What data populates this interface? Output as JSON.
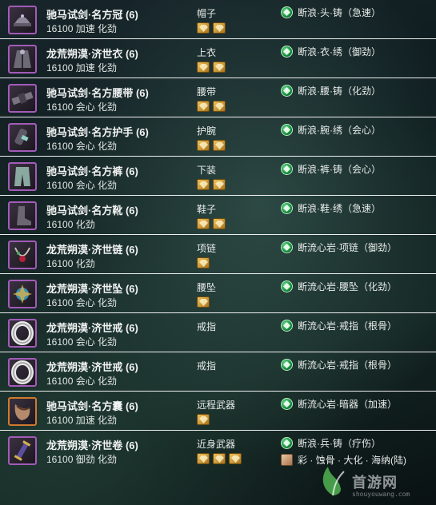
{
  "rows": [
    {
      "name": "驰马试剑·名方冠 (6)",
      "stats": "16100 加速 化劲",
      "slot": "帽子",
      "gems": 2,
      "icon": "hat-icon",
      "enchant": "断浪·头·铸（急速）"
    },
    {
      "name": "龙荒朔漠·济世衣 (6)",
      "stats": "16100 加速 化劲",
      "slot": "上衣",
      "gems": 2,
      "icon": "robe-icon",
      "enchant": "断浪·衣·绣（御劲）"
    },
    {
      "name": "驰马试剑·名方腰带 (6)",
      "stats": "16100 会心 化劲",
      "slot": "腰带",
      "gems": 2,
      "icon": "belt-icon",
      "enchant": "断浪·腰·铸（化劲）"
    },
    {
      "name": "驰马试剑·名方护手 (6)",
      "stats": "16100 会心 化劲",
      "slot": "护腕",
      "gems": 2,
      "icon": "bracer-icon",
      "enchant": "断浪·腕·绣（会心）"
    },
    {
      "name": "驰马试剑·名方裤 (6)",
      "stats": "16100 会心 化劲",
      "slot": "下装",
      "gems": 2,
      "icon": "pants-icon",
      "enchant": "断浪·裤·铸（会心）"
    },
    {
      "name": "驰马试剑·名方靴 (6)",
      "stats": "16100 化劲",
      "slot": "鞋子",
      "gems": 2,
      "icon": "boots-icon",
      "enchant": "断浪·鞋·绣（急速）"
    },
    {
      "name": "龙荒朔漠·济世链 (6)",
      "stats": "16100 化劲",
      "slot": "项链",
      "gems": 1,
      "icon": "necklace-icon",
      "enchant": "断流心岩·项链（御劲）"
    },
    {
      "name": "龙荒朔漠·济世坠 (6)",
      "stats": "16100 会心 化劲",
      "slot": "腰坠",
      "gems": 1,
      "icon": "pendant-icon",
      "enchant": "断流心岩·腰坠（化劲）"
    },
    {
      "name": "龙荒朔漠·济世戒 (6)",
      "stats": "16100 会心 化劲",
      "slot": "戒指",
      "gems": 0,
      "icon": "ring-icon",
      "enchant": "断流心岩·戒指（根骨）"
    },
    {
      "name": "龙荒朔漠·济世戒 (6)",
      "stats": "16100 会心 化劲",
      "slot": "戒指",
      "gems": 0,
      "icon": "ring-icon",
      "enchant": "断流心岩·戒指（根骨）"
    },
    {
      "name": "驰马试剑·名方囊 (6)",
      "stats": "16100 加速 化劲",
      "slot": "远程武器",
      "gems": 1,
      "icon": "pouch-icon",
      "enchant": "断流心岩·暗器（加速）"
    },
    {
      "name": "龙荒朔漠·济世卷 (6)",
      "stats": "16100 御劲 化劲",
      "slot": "近身武器",
      "gems": 3,
      "icon": "scroll-weapon-icon",
      "enchant": "断浪·兵·铸（疗伤）",
      "enchant2": "彩 · 蚀骨 · 大化 · 海纳(陆)"
    }
  ],
  "watermark": {
    "text": "首游网",
    "url": "shouyouwang.com"
  }
}
